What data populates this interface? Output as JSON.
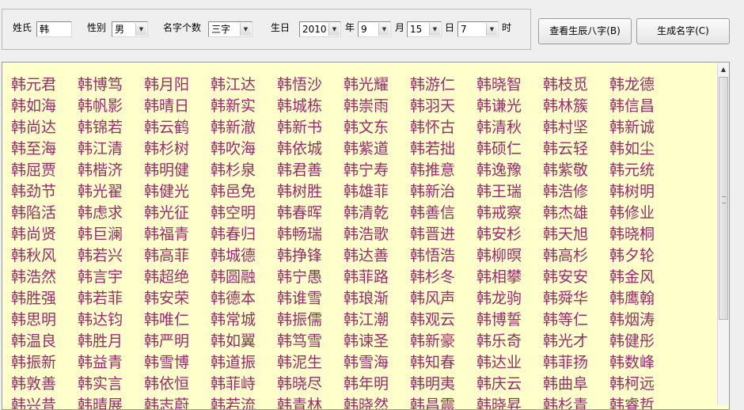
{
  "form": {
    "surname_label": "姓氏",
    "surname_value": "韩",
    "gender_label": "性别",
    "gender_value": "男",
    "name_length_label": "名字个数",
    "name_length_value": "三字",
    "birthday_label": "生日",
    "year_value": "2010",
    "year_label": "年",
    "month_value": "9",
    "month_label": "月",
    "day_value": "15",
    "day_label": "日",
    "hour_value": "7",
    "hour_label": "时"
  },
  "buttons": {
    "bazi_label": "查看生辰八字(B)",
    "generate_label": "生成名字(C)"
  },
  "names": [
    "韩元君",
    "韩博笃",
    "韩月阳",
    "韩江达",
    "韩悟沙",
    "韩光耀",
    "韩游仁",
    "韩晓智",
    "韩枝觅",
    "韩龙德",
    "韩如海",
    "韩帆影",
    "韩晴日",
    "韩新实",
    "韩城栋",
    "韩崇雨",
    "韩羽天",
    "韩谦光",
    "韩林簇",
    "韩信昌",
    "韩尚达",
    "韩锦若",
    "韩云鹤",
    "韩新澈",
    "韩新书",
    "韩文东",
    "韩怀古",
    "韩清秋",
    "韩村坚",
    "韩新诚",
    "韩至海",
    "韩江清",
    "韩杉树",
    "韩吹海",
    "韩依城",
    "韩紫道",
    "韩若拙",
    "韩硕仁",
    "韩云轻",
    "韩如尘",
    "韩屈贾",
    "韩楷济",
    "韩明健",
    "韩杉泉",
    "韩君善",
    "韩宁寿",
    "韩推意",
    "韩逸豫",
    "韩紫敬",
    "韩元统",
    "韩劲节",
    "韩光翟",
    "韩健光",
    "韩邑免",
    "韩树胜",
    "韩雄菲",
    "韩新治",
    "韩王瑞",
    "韩浩修",
    "韩树明",
    "韩陷活",
    "韩虑求",
    "韩光征",
    "韩空明",
    "韩春晖",
    "韩清乾",
    "韩善信",
    "韩戒察",
    "韩杰雄",
    "韩修业",
    "韩尚贤",
    "韩巨澜",
    "韩福青",
    "韩春归",
    "韩畅瑞",
    "韩浩歌",
    "韩晋进",
    "韩安杉",
    "韩天旭",
    "韩晓桐",
    "韩秋风",
    "韩若兴",
    "韩高菲",
    "韩城德",
    "韩挣锋",
    "韩达善",
    "韩悟浩",
    "韩柳暝",
    "韩高杉",
    "韩夕轮",
    "韩浩然",
    "韩言宇",
    "韩超绝",
    "韩圆融",
    "韩宁愚",
    "韩菲路",
    "韩杉冬",
    "韩相攀",
    "韩安安",
    "韩金风",
    "韩胜强",
    "韩若菲",
    "韩安荣",
    "韩德本",
    "韩谁雪",
    "韩琅渐",
    "韩风声",
    "韩龙驹",
    "韩舜华",
    "韩鹰翰",
    "韩思明",
    "韩达钧",
    "韩唯仁",
    "韩常城",
    "韩振儒",
    "韩江潮",
    "韩观云",
    "韩博誓",
    "韩等仁",
    "韩烟涛",
    "韩温良",
    "韩胜月",
    "韩严明",
    "韩如翼",
    "韩笃雪",
    "韩谏圣",
    "韩新豪",
    "韩乐奇",
    "韩光才",
    "韩健彤",
    "韩振新",
    "韩益青",
    "韩雪博",
    "韩道振",
    "韩泥生",
    "韩雪海",
    "韩知春",
    "韩达业",
    "韩菲扬",
    "韩数峰",
    "韩敦善",
    "韩实言",
    "韩依恒",
    "韩菲峙",
    "韩晓尽",
    "韩年明",
    "韩明夷",
    "韩庆云",
    "韩曲阜",
    "韩柯远",
    "韩兴昔",
    "韩晴展",
    "韩志蔚",
    "韩若流",
    "韩青林",
    "韩晓然",
    "韩昌震",
    "韩晓昇",
    "韩杉青",
    "韩睿哲"
  ]
}
